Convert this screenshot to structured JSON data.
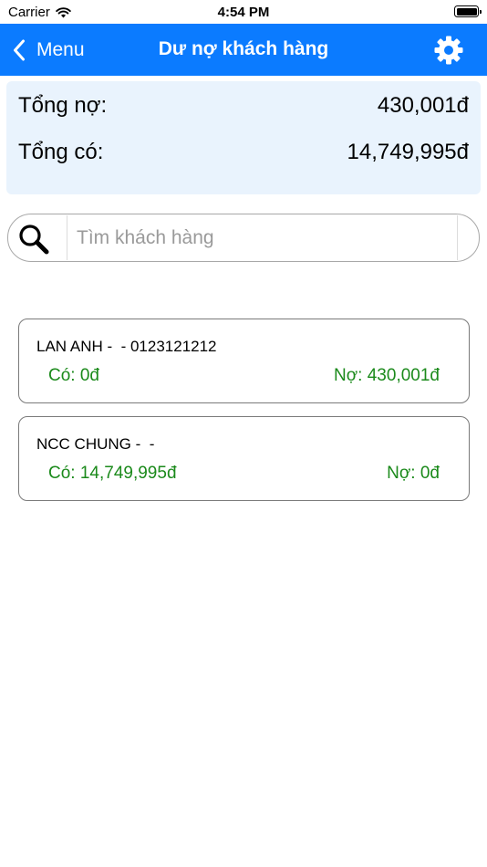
{
  "status_bar": {
    "carrier": "Carrier",
    "time": "4:54 PM"
  },
  "nav": {
    "back_label": "Menu",
    "title": "Dư nợ khách hàng",
    "back_icon": "chevron-left-icon",
    "settings_icon": "gear-icon",
    "background_color": "#0b7bff"
  },
  "summary": {
    "debt_label": "Tổng nợ:",
    "debt_value": "430,001đ",
    "credit_label": "Tổng có:",
    "credit_value": "14,749,995đ"
  },
  "search": {
    "placeholder": "Tìm khách hàng",
    "value": ""
  },
  "customers": [
    {
      "name": "LAN ANH -  - 0123121212",
      "credit": "Có: 0đ",
      "debt": "Nợ: 430,001đ"
    },
    {
      "name": "NCC CHUNG -  -",
      "credit": "Có: 14,749,995đ",
      "debt": "Nợ: 0đ"
    }
  ],
  "colors": {
    "accent": "#0b7bff",
    "amount_green": "#1b8a1b",
    "summary_bg": "#e9f3fd"
  }
}
